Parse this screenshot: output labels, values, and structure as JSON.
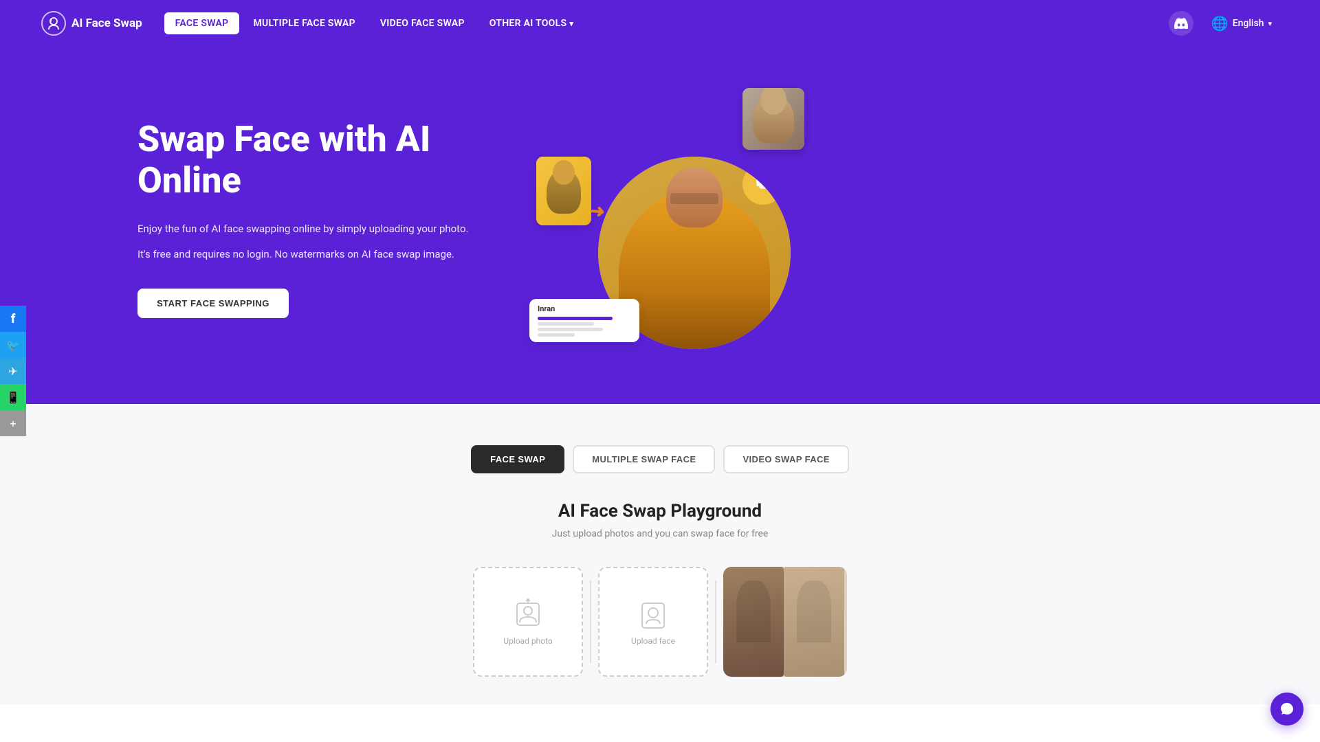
{
  "brand": {
    "name": "AI Face Swap",
    "logo_icon": "🤖"
  },
  "navbar": {
    "links": [
      {
        "id": "face-swap",
        "label": "FACE SWAP",
        "active": true
      },
      {
        "id": "multiple-face-swap",
        "label": "MULTIPLE FACE SWAP",
        "active": false
      },
      {
        "id": "video-face-swap",
        "label": "VIDEO FACE SWAP",
        "active": false
      },
      {
        "id": "other-ai-tools",
        "label": "OTHER AI TOOLS",
        "active": false,
        "dropdown": true
      }
    ],
    "lang": "English",
    "discord_title": "Discord"
  },
  "hero": {
    "title": "Swap Face with AI Online",
    "desc1": "Enjoy the fun of AI face swapping online by simply uploading your photo.",
    "desc2": "It's free and requires no login. No watermarks on AI face swap image.",
    "cta": "START FACE SWAPPING"
  },
  "lower": {
    "tabs": [
      {
        "id": "face-swap",
        "label": "FACE SWAP",
        "active": true
      },
      {
        "id": "multiple-swap-face",
        "label": "MULTIPLE SWAP FACE",
        "active": false
      },
      {
        "id": "video-swap-face",
        "label": "VIDEO SWAP FACE",
        "active": false
      }
    ],
    "playground_title": "AI Face Swap Playground",
    "playground_subtitle": "Just upload photos and you can swap face for free",
    "upload_card1_label": "Upload photo",
    "upload_card2_label": "Upload face"
  },
  "social": [
    {
      "id": "facebook",
      "icon": "f",
      "label": "Facebook"
    },
    {
      "id": "twitter",
      "icon": "🐦",
      "label": "Twitter"
    },
    {
      "id": "telegram",
      "icon": "✈",
      "label": "Telegram"
    },
    {
      "id": "whatsapp",
      "icon": "📱",
      "label": "WhatsApp"
    },
    {
      "id": "more",
      "icon": "+",
      "label": "More"
    }
  ],
  "colors": {
    "primary": "#5b21d6",
    "hero_bg": "#5b21d6",
    "cta_bg": "#ffffff",
    "active_tab_bg": "#2a2a2a"
  }
}
